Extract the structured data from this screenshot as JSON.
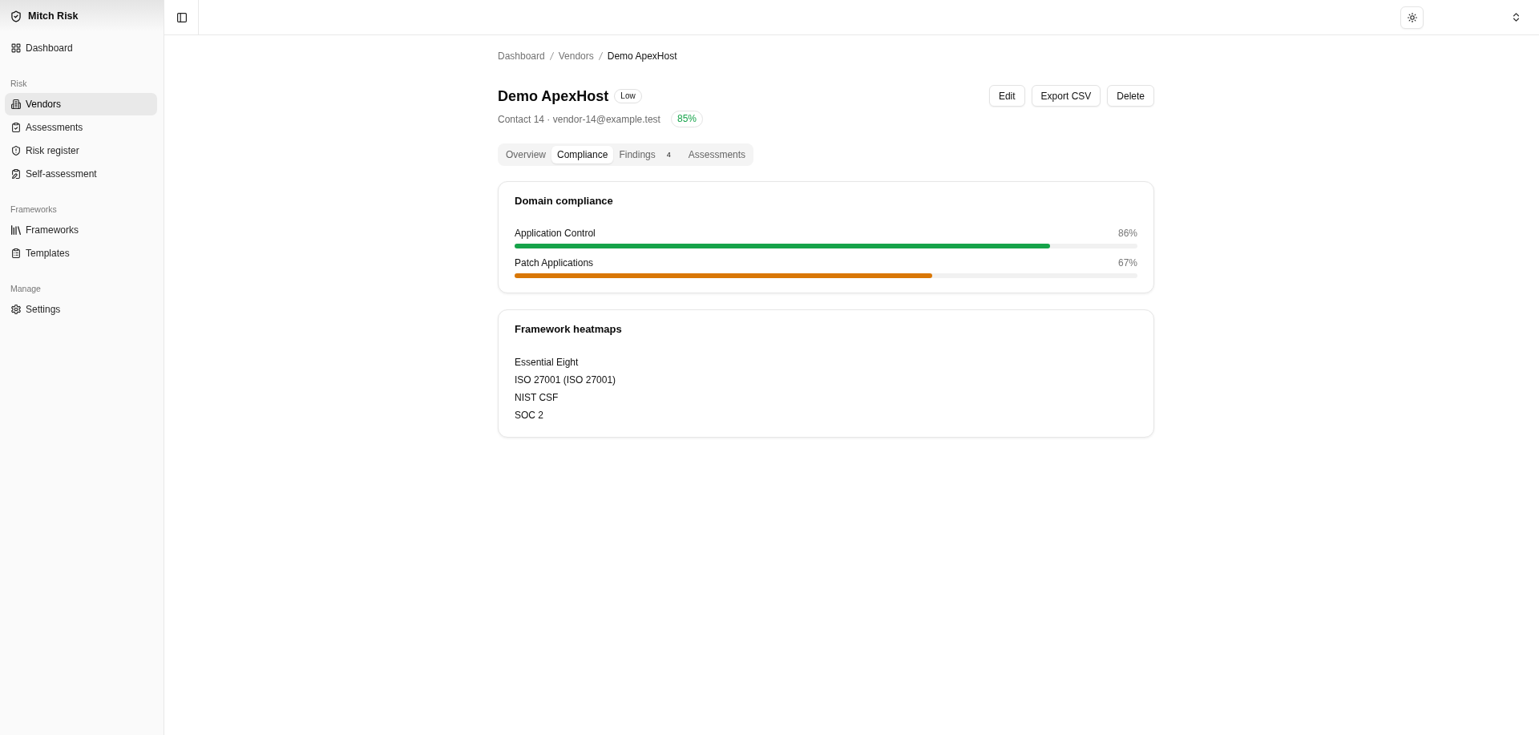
{
  "sidebar": {
    "brand": "Mitch Risk",
    "sections": [
      {
        "items": [
          {
            "label": "Dashboard",
            "selected": false
          }
        ]
      },
      {
        "heading": "Risk",
        "items": [
          {
            "label": "Vendors",
            "selected": true
          },
          {
            "label": "Assessments",
            "selected": false
          },
          {
            "label": "Risk register",
            "selected": false
          },
          {
            "label": "Self-assessment",
            "selected": false
          }
        ]
      },
      {
        "heading": "Frameworks",
        "items": [
          {
            "label": "Frameworks",
            "selected": false
          },
          {
            "label": "Templates",
            "selected": false
          }
        ]
      },
      {
        "heading": "Manage",
        "items": [
          {
            "label": "Settings",
            "selected": false
          }
        ]
      }
    ]
  },
  "breadcrumb": [
    "Dashboard",
    "Vendors",
    "Demo ApexHost"
  ],
  "vendor": {
    "name": "Demo ApexHost",
    "risk_level": "Low",
    "contact": "Contact 14 · vendor-14@example.test",
    "score": "85%"
  },
  "actions": [
    "Edit",
    "Export CSV",
    "Delete"
  ],
  "tabs": [
    {
      "label": "Overview",
      "selected": false
    },
    {
      "label": "Compliance",
      "selected": true
    },
    {
      "label": "Findings",
      "count": "4",
      "selected": false
    },
    {
      "label": "Assessments",
      "selected": false
    }
  ],
  "domain_compliance": {
    "title": "Domain compliance",
    "domains": [
      {
        "name": "Application Control",
        "reading": "86%",
        "level": 0.86,
        "color": "#16a34a"
      },
      {
        "name": "Patch Applications",
        "reading": "67%",
        "level": 0.67,
        "color": "#d97706"
      }
    ]
  },
  "framework_heatmaps": {
    "title": "Framework heatmaps",
    "frameworks": [
      "Essential Eight",
      "ISO 27001 (ISO 27001)",
      "NIST CSF",
      "SOC 2"
    ]
  }
}
